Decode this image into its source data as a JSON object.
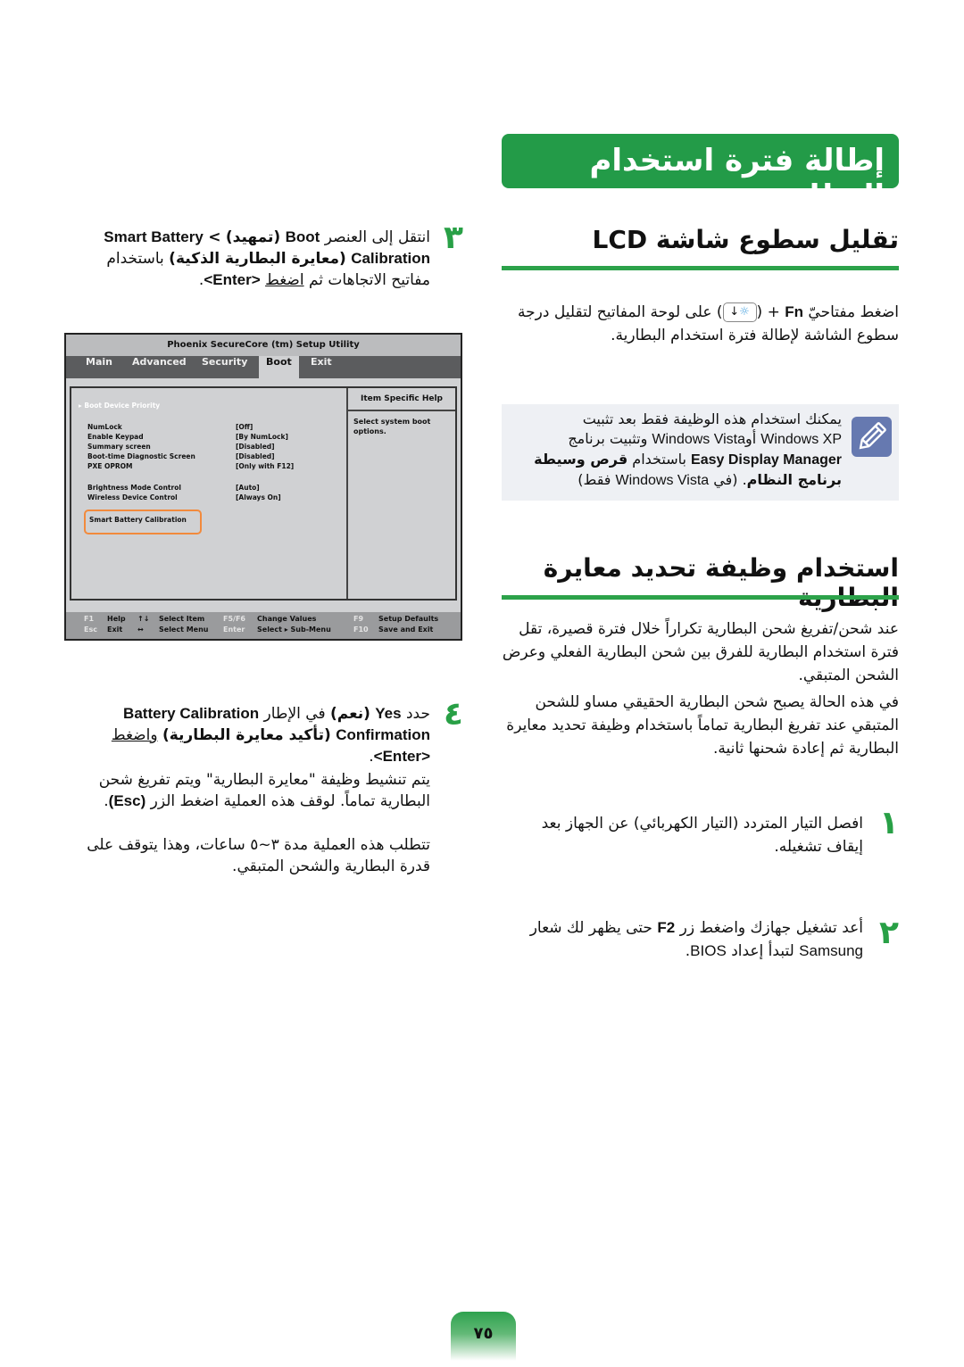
{
  "title": "إطالة فترة استخدام البطارية",
  "colors": {
    "accent_green": "#239b48",
    "note_bg": "#eef0f4",
    "note_icon": "#6679b0",
    "bios_highlight": "#f28a3c"
  },
  "lcd_section": {
    "heading": "تقليل سطوع شاشة LCD",
    "para_pre": "اضغط مفتاحيّ",
    "para_key": "Fn",
    "para_plus": "+",
    "key_icon": "brightness-down-key-icon",
    "para_post": "على لوحة المفاتيح لتقليل درجة سطوع الشاشة لإطالة فترة استخدام البطارية."
  },
  "note": {
    "icon": "pencil-note-icon",
    "line1": "يمكنك استخدام هذه الوظيفة فقط بعد تثبيت",
    "line2_a": "Windows XP",
    "line2_b": "أو",
    "line2_c": "Windows Vista",
    "line2_d": "وتثبيت برنامج",
    "line3_a": "Easy Display Manager",
    "line3_b": "باستخدام",
    "line3_c": "قرص وسيطة",
    "line4_a": "برنامج النظام",
    "line4_b": ". (في",
    "line4_c": "Windows Vista",
    "line4_d": "فقط)"
  },
  "calibration_section": {
    "heading": "استخدام وظيفة تحديد معايرة البطارية",
    "para1": "عند شحن/تفريغ شحن البطارية تكراراً خلال فترة قصيرة، تقل فترة استخدام البطارية للفرق بين شحن البطارية الفعلي وعرض الشحن المتبقي.",
    "para2": "في هذه الحالة يصبح شحن البطارية الحقيقي مساو للشحن المتبقي عند تفريغ البطارية تماماً باستخدام وظيفة تحديد معايرة البطارية ثم إعادة شحنها ثانية."
  },
  "steps": [
    {
      "num": "١",
      "text": "افصل التيار المتردد (التيار الكهربائي) عن الجهاز بعد إيقاف تشغيله."
    },
    {
      "num": "٢",
      "text_a": "أعد تشغيل جهازك واضغط زر",
      "key": "F2",
      "text_b": "حتى يظهر لك شعار",
      "brand": "Samsung",
      "text_c": "لتبدأ إعداد",
      "bios": "BIOS",
      "text_d": "."
    },
    {
      "num": "٣",
      "text_a": "انتقل إلى العنصر",
      "b1": "Boot",
      "b2": "(تمهيد)",
      "gt": ">",
      "b3": "Smart Battery Calibration",
      "b4": "(معايرة البطارية الذكية)",
      "text_b": "باستخدام مفاتيح الاتجاهات ثم",
      "press": "اضغط",
      "enter": "<Enter>",
      "dot": "."
    },
    {
      "num": "٤",
      "text_a": "حدد",
      "b1": "Yes",
      "b2": "(نعم)",
      "text_b": "في الإطار",
      "b3": "Battery Calibration Confirmation",
      "b4": "(تأكيد معايرة البطارية)",
      "text_c": "واضغط",
      "enter": "<Enter>",
      "dot": ".",
      "sub1": "يتم تنشيط وظيفة \"معايرة البطارية\" ويتم تفريغ شحن البطارية تماماً. لوقف هذه العملية اضغط الزر",
      "esc": "(Esc)",
      "sub1_end": ".",
      "sub2": "تتطلب هذه العملية مدة ٣~٥ ساعات، وهذا يتوقف على قدرة البطارية والشحن المتبقي."
    }
  ],
  "bios": {
    "title": "Phoenix SecureCore (tm) Setup Utility",
    "tabs": [
      "Main",
      "Advanced",
      "Security",
      "Boot",
      "Exit"
    ],
    "active_tab": "Boot",
    "priority": "▸ Boot Device Priority",
    "items": [
      {
        "label": "NumLock",
        "value": "[Off]"
      },
      {
        "label": "Enable Keypad",
        "value": "[By NumLock]"
      },
      {
        "label": "Summary screen",
        "value": "[Disabled]"
      },
      {
        "label": "Boot-time Diagnostic Screen",
        "value": "[Disabled]"
      },
      {
        "label": "PXE OPROM",
        "value": "[Only with F12]"
      },
      {
        "label": "Brightness Mode Control",
        "value": "[Auto]"
      },
      {
        "label": "Wireless Device Control",
        "value": "[Always On]"
      },
      {
        "label": "Smart Battery Calibration",
        "value": ""
      }
    ],
    "help_header": "Item Specific Help",
    "help_text": "Select system boot options.",
    "footer": [
      {
        "key": "F1",
        "desc": "Help"
      },
      {
        "key": "Esc",
        "desc": "Exit"
      },
      {
        "key": "↑↓",
        "desc": "Select Item"
      },
      {
        "key": "↔",
        "desc": "Select Menu"
      },
      {
        "key": "F5/F6",
        "desc": "Change Values"
      },
      {
        "key": "Enter",
        "desc": "Select ▸ Sub-Menu"
      },
      {
        "key": "F9",
        "desc": "Setup Defaults"
      },
      {
        "key": "F10",
        "desc": "Save and Exit"
      }
    ]
  },
  "page_number": "٧٥"
}
